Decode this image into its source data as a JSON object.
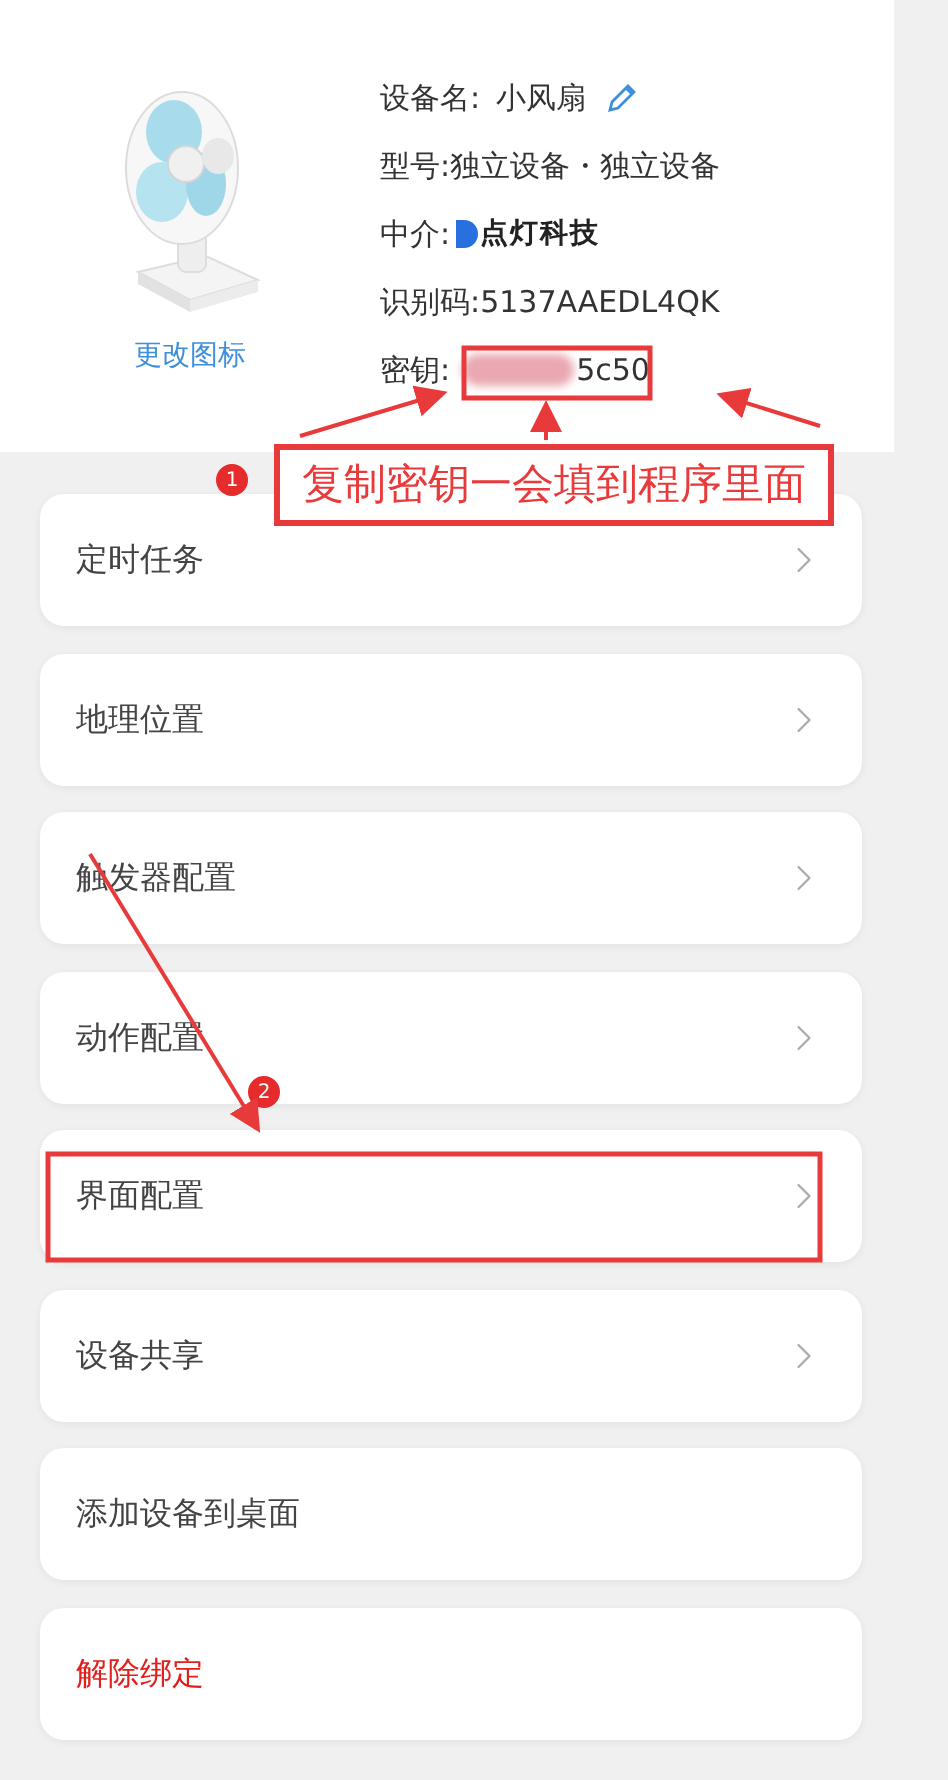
{
  "device": {
    "change_icon": "更改图标",
    "fields": [
      {
        "kind": "name",
        "label": "设备名:",
        "value": "小风扇"
      },
      {
        "kind": "text",
        "label": "型号:",
        "value": "独立设备・独立设备"
      },
      {
        "kind": "brand",
        "label": "中介:",
        "value": "点灯科技"
      },
      {
        "kind": "text",
        "label": "识别码:",
        "value": "5137AAEDL4QK"
      },
      {
        "kind": "secret",
        "label": "密钥:",
        "value": "5c50"
      }
    ]
  },
  "menu": [
    {
      "label": "定时任务",
      "kind": "nav"
    },
    {
      "label": "地理位置",
      "kind": "nav"
    },
    {
      "label": "触发器配置",
      "kind": "nav"
    },
    {
      "label": "动作配置",
      "kind": "nav"
    },
    {
      "label": "界面配置",
      "kind": "nav"
    },
    {
      "label": "设备共享",
      "kind": "nav"
    },
    {
      "label": "添加设备到桌面",
      "kind": "plain"
    },
    {
      "label": "解除绑定",
      "kind": "danger"
    }
  ],
  "annotations": {
    "callout": "复制密钥一会填到程序里面",
    "badges": [
      "1",
      "2"
    ]
  }
}
